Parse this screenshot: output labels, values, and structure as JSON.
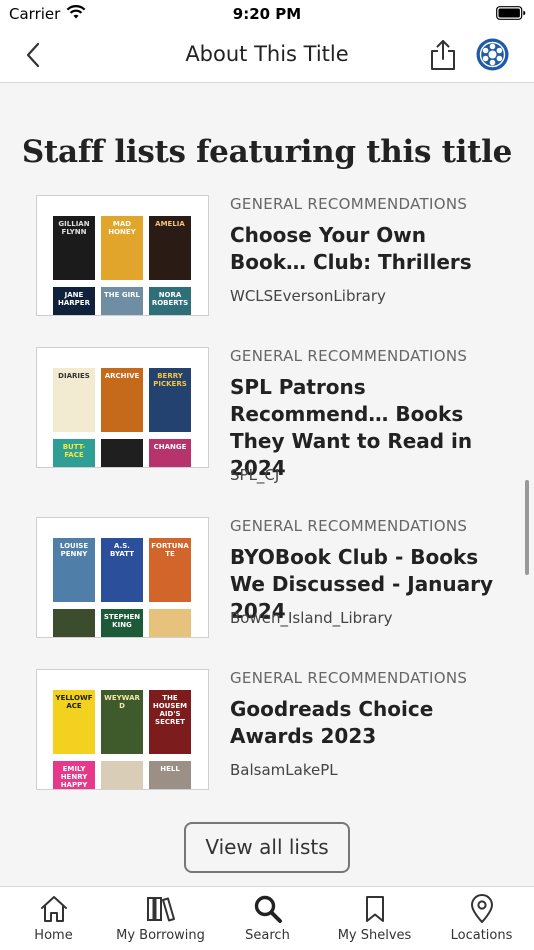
{
  "status_bar": {
    "carrier": "Carrier",
    "time": "9:20 PM"
  },
  "nav": {
    "title": "About This Title"
  },
  "section": {
    "heading": "Staff lists featuring this title"
  },
  "lists": [
    {
      "category": "GENERAL RECOMMENDATIONS",
      "title": "Choose Your Own Book… Club: Thrillers",
      "owner": "WCLSEversonLibrary",
      "covers": [
        {
          "text": "GILLIAN FLYNN",
          "bg": "#1b1b1b",
          "fg": "#e0e0e0"
        },
        {
          "text": "MAD HONEY",
          "bg": "#e0a52a",
          "fg": "#ffffff"
        },
        {
          "text": "AMELIA",
          "bg": "#2a1b14",
          "fg": "#f1c27a"
        },
        {
          "text": "JANE HARPER",
          "bg": "#10213b",
          "fg": "#ffffff"
        },
        {
          "text": "THE GIRL",
          "bg": "#6f8ea3",
          "fg": "#ffffff"
        },
        {
          "text": "NORA ROBERTS",
          "bg": "#2e6f7a",
          "fg": "#ffffff"
        }
      ]
    },
    {
      "category": "GENERAL RECOMMENDATIONS",
      "title": "SPL Patrons Recommend… Books They Want to Read in 2024",
      "owner": "SPL_CJ",
      "covers": [
        {
          "text": "DIARIES",
          "bg": "#f3ead2",
          "fg": "#333333"
        },
        {
          "text": "ARCHIVE",
          "bg": "#c46a1a",
          "fg": "#ffffff"
        },
        {
          "text": "BERRY PICKERS",
          "bg": "#23426f",
          "fg": "#f5c542"
        },
        {
          "text": "BUTT-FACE",
          "bg": "#2f9f95",
          "fg": "#f7ea3a"
        },
        {
          "text": "",
          "bg": "#1f1f1f",
          "fg": "#e08a2a"
        },
        {
          "text": "CHANGE",
          "bg": "#b7336b",
          "fg": "#ffffff"
        }
      ]
    },
    {
      "category": "GENERAL RECOMMENDATIONS",
      "title": "BYOBook Club - Books We Discussed - January 2024",
      "owner": "Bowen_Island_Library",
      "covers": [
        {
          "text": "LOUISE PENNY",
          "bg": "#4f7fa8",
          "fg": "#ffffff"
        },
        {
          "text": "A.S. BYATT",
          "bg": "#2c4f9c",
          "fg": "#ffffff"
        },
        {
          "text": "FORTUNATE",
          "bg": "#d2662a",
          "fg": "#ffffff"
        },
        {
          "text": "",
          "bg": "#3b4d2c",
          "fg": "#ffffff"
        },
        {
          "text": "STEPHEN KING",
          "bg": "#1d5a37",
          "fg": "#ffffff"
        },
        {
          "text": "",
          "bg": "#e6c27d",
          "fg": "#333333"
        }
      ]
    },
    {
      "category": "GENERAL RECOMMENDATIONS",
      "title": "Goodreads Choice Awards 2023",
      "owner": "BalsamLakePL",
      "covers": [
        {
          "text": "YELLOWFACE",
          "bg": "#f2d21f",
          "fg": "#1c1c1c"
        },
        {
          "text": "WEYWARD",
          "bg": "#3f5a2b",
          "fg": "#f3e7b0"
        },
        {
          "text": "THE HOUSEMAID'S SECRET",
          "bg": "#7d1c1c",
          "fg": "#ffffff"
        },
        {
          "text": "EMILY HENRY HAPPY",
          "bg": "#e8388a",
          "fg": "#ffffff"
        },
        {
          "text": "",
          "bg": "#d9cdb8",
          "fg": "#333333"
        },
        {
          "text": "HELL",
          "bg": "#9c8f86",
          "fg": "#ffffff"
        }
      ]
    }
  ],
  "view_all": {
    "label": "View all lists"
  },
  "tabs": [
    {
      "label": "Home",
      "icon": "home-icon"
    },
    {
      "label": "My Borrowing",
      "icon": "books-icon"
    },
    {
      "label": "Search",
      "icon": "search-icon"
    },
    {
      "label": "My Shelves",
      "icon": "bookmark-icon"
    },
    {
      "label": "Locations",
      "icon": "location-pin-icon"
    }
  ],
  "colors": {
    "background": "#f5f5f5",
    "accent": "#1e5aa8",
    "text": "#222222"
  }
}
